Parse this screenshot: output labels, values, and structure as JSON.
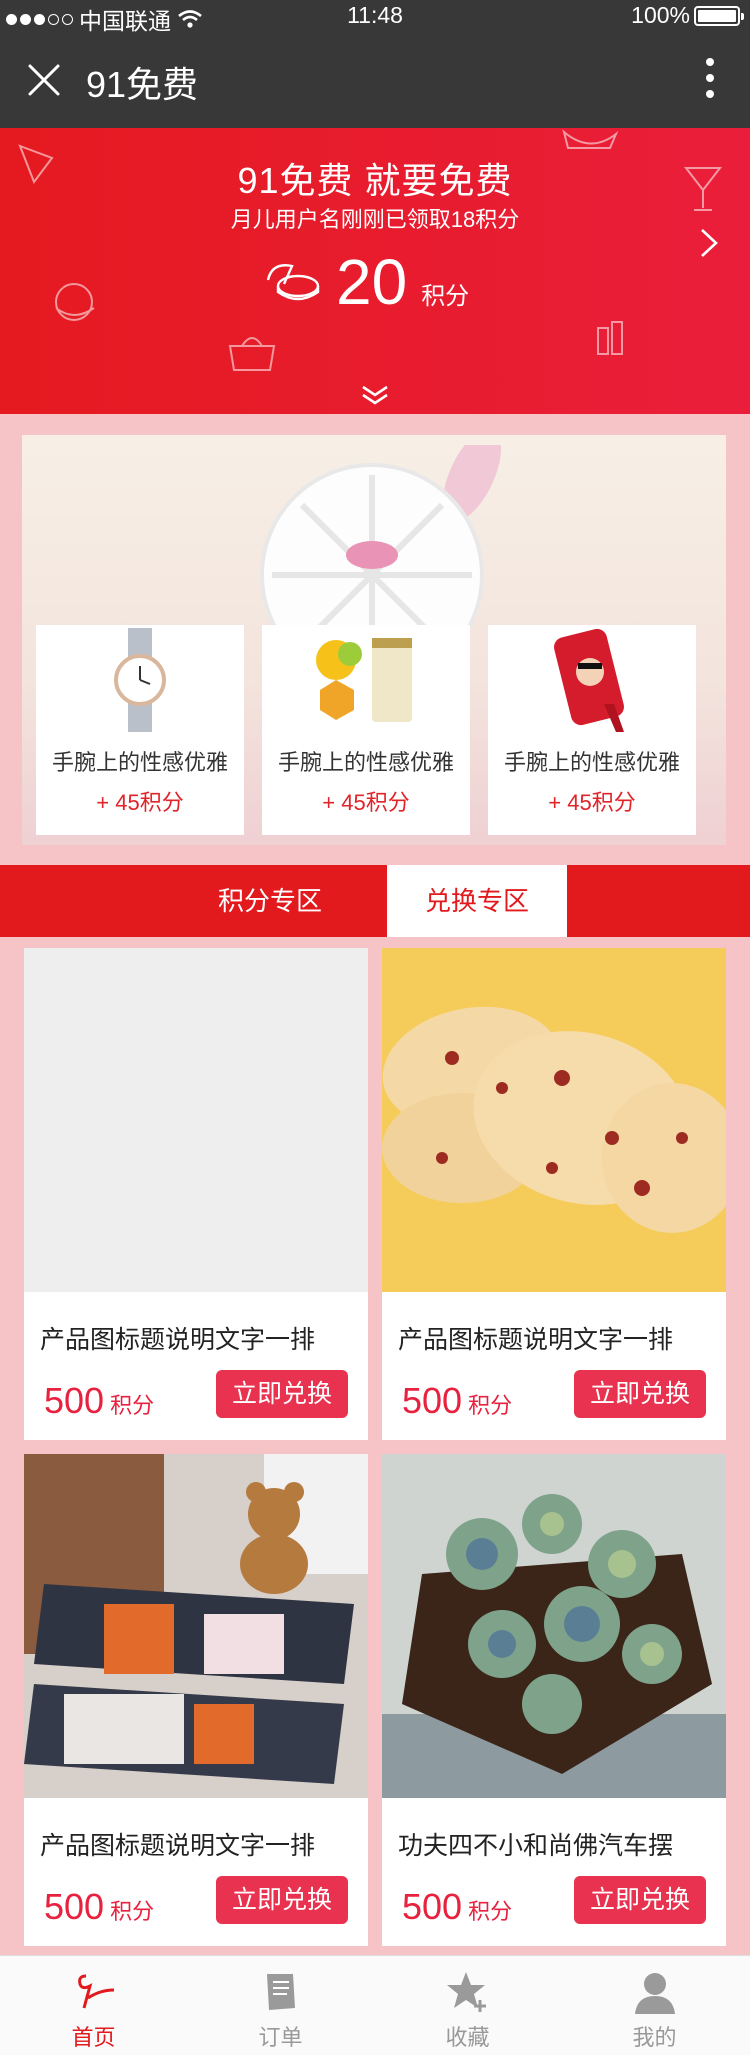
{
  "status_bar": {
    "carrier": "中国联通",
    "time": "11:48",
    "battery": "100%"
  },
  "nav": {
    "title": "91免费"
  },
  "banner": {
    "headline": "91免费  就要免费",
    "subline": "月儿用户名刚刚已领取18积分",
    "points_value": "20",
    "points_unit": "积分"
  },
  "promo": {
    "items": [
      {
        "name": "手腕上的性感优雅",
        "points": "+ 45积分",
        "image": "watch"
      },
      {
        "name": "手腕上的性感优雅",
        "points": "+ 45积分",
        "image": "honey-tea"
      },
      {
        "name": "手腕上的性感优雅",
        "points": "+ 45积分",
        "image": "phone-case"
      }
    ]
  },
  "tabs": [
    {
      "label": "积分专区",
      "active": false
    },
    {
      "label": "兑换专区",
      "active": true
    }
  ],
  "products": [
    {
      "name": "产品图标题说明文字一排",
      "price": "500",
      "unit": "积分",
      "button": "立即兑换",
      "image": "placeholder"
    },
    {
      "name": "产品图标题说明文字一排",
      "price": "500",
      "unit": "积分",
      "button": "立即兑换",
      "image": "cookies"
    },
    {
      "name": "产品图标题说明文字一排",
      "price": "500",
      "unit": "积分",
      "button": "立即兑换",
      "image": "teddy-pillows"
    },
    {
      "name": "功夫四不小和尚佛汽车摆",
      "price": "500",
      "unit": "积分",
      "button": "立即兑换",
      "image": "succulents"
    }
  ],
  "tabbar": [
    {
      "label": "首页",
      "icon": "home-logo-icon",
      "active": true
    },
    {
      "label": "订单",
      "icon": "order-icon",
      "active": false
    },
    {
      "label": "收藏",
      "icon": "star-plus-icon",
      "active": false
    },
    {
      "label": "我的",
      "icon": "user-icon",
      "active": false
    }
  ],
  "colors": {
    "brand_red": "#e2191d",
    "button_red": "#e8324f",
    "page_bg": "#f6c3c6",
    "nav_bg": "#383838"
  }
}
